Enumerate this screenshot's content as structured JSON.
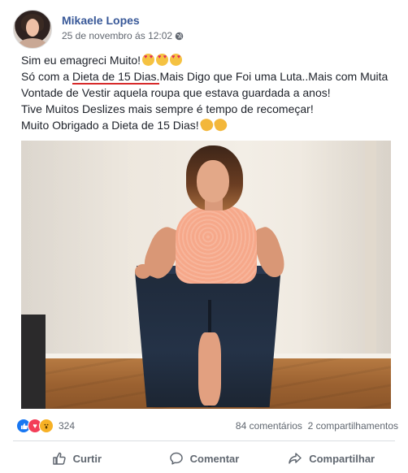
{
  "post": {
    "author": "Mikaele Lopes",
    "date": "25 de novembro ás 12:02",
    "privacy_icon": "globe-icon",
    "lines": {
      "l1": "Sim eu emagreci Muito!",
      "l2_pre": "Só com a ",
      "l2_highlight": "Dieta de 15 Dias.",
      "l2_post": "Mais Digo que Foi uma Luta..Mais com Muita",
      "l3": "Vontade de Vestir aquela roupa que estava guardada a anos!",
      "l4": "Tive Muitos Deslizes mais sempre é tempo de recomeçar!",
      "l5": "Muito Obrigado a Dieta de 15 Dias!"
    },
    "highlight_color": "#d72a2a"
  },
  "reactions": {
    "icons": [
      "like-icon",
      "love-icon",
      "wow-icon"
    ],
    "count": "324",
    "comments": "84 comentários",
    "shares": "2 compartilhamentos"
  },
  "actions": {
    "like": "Curtir",
    "comment": "Comentar",
    "share": "Compartilhar"
  },
  "colors": {
    "name_link": "#385898",
    "like_blue": "#1877f2",
    "love_red": "#f33e58",
    "wow_yellow": "#f7b125"
  }
}
